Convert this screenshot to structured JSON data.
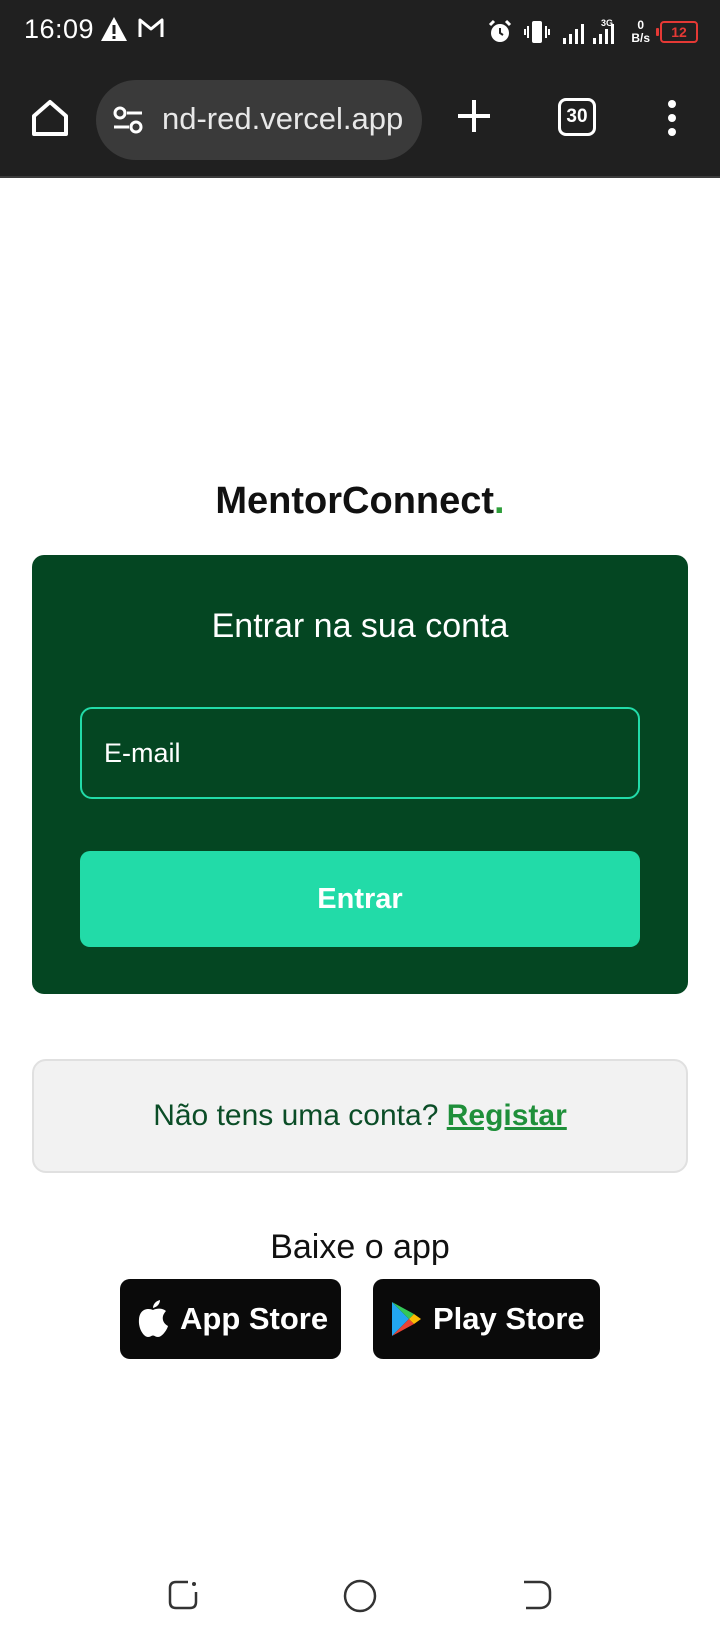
{
  "status_bar": {
    "time": "16:09",
    "net_speed_value": "0",
    "net_speed_unit": "B/s",
    "battery": "12",
    "network_type": "3G"
  },
  "browser": {
    "url": "nd-red.vercel.app",
    "tab_count": "30"
  },
  "page": {
    "brand_name": "MentorConnect",
    "brand_dot": ".",
    "login_card": {
      "title": "Entrar na sua conta",
      "email_placeholder": "E-mail",
      "submit_label": "Entrar"
    },
    "register": {
      "prompt": "Não tens uma conta?",
      "link_label": "Registar"
    },
    "download": {
      "title": "Baixe o app",
      "app_store_label": "App Store",
      "play_store_label": "Play Store"
    }
  },
  "colors": {
    "card_bg": "#044622",
    "accent": "#22dba8",
    "brand_dot": "#2e9e3a",
    "link": "#1f8f3a"
  },
  "icons": [
    "warning-icon",
    "gmail-icon",
    "alarm-icon",
    "vibrate-icon",
    "signal-icon",
    "battery-icon",
    "home-icon",
    "site-settings-icon",
    "new-tab-icon",
    "tabs-icon",
    "menu-icon",
    "apple-icon",
    "play-store-icon",
    "recents-icon",
    "home-nav-icon",
    "back-icon"
  ]
}
